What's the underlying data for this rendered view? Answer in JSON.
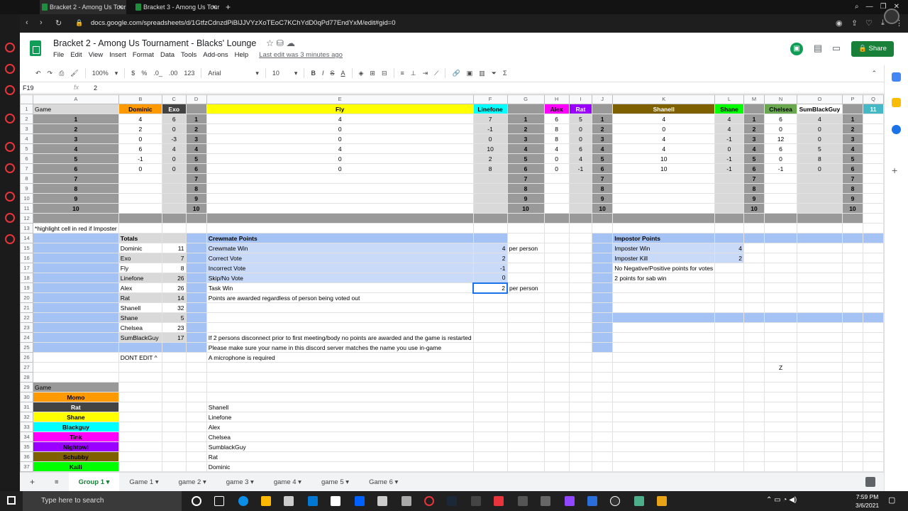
{
  "browser": {
    "tabs": [
      {
        "label": "Bracket 2 - Among Us Tour"
      },
      {
        "label": "Bracket 3 - Among Us Tour"
      }
    ],
    "url": "docs.google.com/spreadsheets/d/1GtfzCdnzdPiBlJJVYzXoTEoC7KChYdD0qPd77EndYxM/edit#gid=0"
  },
  "doc": {
    "title": "Bracket 2 - Among Us Tournament - Blacks' Lounge",
    "menu": [
      "File",
      "Edit",
      "View",
      "Insert",
      "Format",
      "Data",
      "Tools",
      "Add-ons",
      "Help"
    ],
    "last_edit": "Last edit was 3 minutes ago",
    "share": "Share"
  },
  "toolbar": {
    "zoom": "100%",
    "currency": "$",
    "percent": "%",
    "dec1": ".0_",
    "dec2": ".00",
    "fmt": "123",
    "font": "Arial",
    "size": "10"
  },
  "formula": {
    "cell": "F19",
    "fx": "fx",
    "value": "2"
  },
  "grid": {
    "cols": [
      "",
      "A",
      "B",
      "C",
      "D",
      "E",
      "F",
      "G",
      "H",
      "I",
      "J",
      "K",
      "L",
      "M",
      "N",
      "O",
      "P",
      "Q"
    ],
    "rows": [
      [
        "1",
        "Game",
        "Dominic",
        "Exo",
        "",
        "Fly",
        "Linefone",
        "",
        "Alex",
        "Rat",
        "",
        "Shanell",
        "Shane",
        "",
        "Chelsea",
        "SumBlackGuy",
        "",
        "11"
      ],
      [
        "2",
        "1",
        "4",
        "6",
        "1",
        "4",
        "7",
        "1",
        "6",
        "5",
        "1",
        "4",
        "4",
        "1",
        "6",
        "4",
        "1",
        ""
      ],
      [
        "3",
        "2",
        "2",
        "0",
        "2",
        "0",
        "-1",
        "2",
        "8",
        "0",
        "2",
        "0",
        "4",
        "2",
        "0",
        "0",
        "2",
        ""
      ],
      [
        "4",
        "3",
        "0",
        "-3",
        "3",
        "0",
        "0",
        "3",
        "8",
        "0",
        "3",
        "4",
        "-1",
        "3",
        "12",
        "0",
        "3",
        ""
      ],
      [
        "5",
        "4",
        "6",
        "4",
        "4",
        "4",
        "10",
        "4",
        "4",
        "6",
        "4",
        "4",
        "0",
        "4",
        "6",
        "5",
        "4",
        ""
      ],
      [
        "6",
        "5",
        "-1",
        "0",
        "5",
        "0",
        "2",
        "5",
        "0",
        "4",
        "5",
        "10",
        "-1",
        "5",
        "0",
        "8",
        "5",
        ""
      ],
      [
        "7",
        "6",
        "0",
        "0",
        "6",
        "0",
        "8",
        "6",
        "0",
        "-1",
        "6",
        "10",
        "-1",
        "6",
        "-1",
        "0",
        "6",
        ""
      ],
      [
        "8",
        "7",
        "",
        "",
        "7",
        "",
        "",
        "7",
        "",
        "",
        "7",
        "",
        "",
        "7",
        "",
        "",
        "7",
        ""
      ],
      [
        "9",
        "8",
        "",
        "",
        "8",
        "",
        "",
        "8",
        "",
        "",
        "8",
        "",
        "",
        "8",
        "",
        "",
        "8",
        ""
      ],
      [
        "10",
        "9",
        "",
        "",
        "9",
        "",
        "",
        "9",
        "",
        "",
        "9",
        "",
        "",
        "9",
        "",
        "",
        "9",
        ""
      ],
      [
        "11",
        "10",
        "",
        "",
        "10",
        "",
        "",
        "10",
        "",
        "",
        "10",
        "",
        "",
        "10",
        "",
        "",
        "10",
        ""
      ],
      [
        "12",
        "",
        "",
        "",
        "",
        "",
        "",
        "",
        "",
        "",
        "",
        "",
        "",
        "",
        "",
        "",
        "",
        ""
      ],
      [
        "13",
        "*highlight cell in red if Imposter",
        "",
        "",
        "",
        "",
        "",
        "",
        "",
        "",
        "",
        "",
        "",
        "",
        "",
        "",
        "",
        ""
      ],
      [
        "14",
        "",
        "Totals",
        "",
        "",
        "Crewmate Points",
        "",
        "",
        "",
        "",
        "",
        "Impostor Points",
        "",
        "",
        "",
        "",
        "",
        ""
      ],
      [
        "15",
        "",
        "Dominic",
        "11",
        "",
        "Crewmate Win",
        "4",
        "per person",
        "",
        "",
        "",
        "Imposter Win",
        "4",
        "",
        "",
        "",
        "",
        ""
      ],
      [
        "16",
        "",
        "Exo",
        "7",
        "",
        "Correct Vote",
        "2",
        "",
        "",
        "",
        "",
        "Imposter Kill",
        "2",
        "",
        "",
        "",
        "",
        ""
      ],
      [
        "17",
        "",
        "Fly",
        "8",
        "",
        "Incorrect Vote",
        "-1",
        "",
        "",
        "",
        "",
        "No Negative/Positive points for votes",
        "",
        "",
        "",
        "",
        "",
        ""
      ],
      [
        "18",
        "",
        "Linefone",
        "26",
        "",
        "Skip/No Vote",
        "0",
        "",
        "",
        "",
        "",
        "2 points for sab win",
        "",
        "",
        "",
        "",
        "",
        ""
      ],
      [
        "19",
        "",
        "Alex",
        "26",
        "",
        "Task Win",
        "2",
        "per person",
        "",
        "",
        "",
        "",
        "",
        "",
        "",
        "",
        "",
        ""
      ],
      [
        "20",
        "",
        "Rat",
        "14",
        "",
        "Points are awarded regardless of person being voted out",
        "",
        "",
        "",
        "",
        "",
        "",
        "",
        "",
        "",
        "",
        "",
        ""
      ],
      [
        "21",
        "",
        "Shanell",
        "32",
        "",
        "",
        "",
        "",
        "",
        "",
        "",
        "",
        "",
        "",
        "",
        "",
        "",
        ""
      ],
      [
        "22",
        "",
        "Shane",
        "5",
        "",
        "",
        "",
        "",
        "",
        "",
        "",
        "",
        "",
        "",
        "",
        "",
        "",
        ""
      ],
      [
        "23",
        "",
        "Chelsea",
        "23",
        "",
        "",
        "",
        "",
        "",
        "",
        "",
        "",
        "",
        "",
        "",
        "",
        "",
        ""
      ],
      [
        "24",
        "",
        "SumBlackGuy",
        "17",
        "",
        "If 2 persons disconnect prior to first meeting/body no points are awarded and the game is restarted",
        "",
        "",
        "",
        "",
        "",
        "",
        "",
        "",
        "",
        "",
        "",
        ""
      ],
      [
        "25",
        "",
        "",
        "",
        "",
        "Please make sure your name in this discord server matches the name you use in-game",
        "",
        "",
        "",
        "",
        "",
        "",
        "",
        "",
        "",
        "",
        "",
        ""
      ],
      [
        "26",
        "",
        "DONT EDIT ^",
        "",
        "",
        "A microphone is required",
        "",
        "",
        "",
        "",
        "",
        "",
        "",
        "",
        "",
        "",
        "",
        ""
      ],
      [
        "27",
        "",
        "",
        "",
        "",
        "",
        "",
        "",
        "",
        "",
        "",
        "",
        "",
        "",
        "Z",
        "",
        "",
        ""
      ],
      [
        "28",
        "",
        "",
        "",
        "",
        "",
        "",
        "",
        "",
        "",
        "",
        "",
        "",
        "",
        "",
        "",
        "",
        ""
      ],
      [
        "29",
        "Game",
        "",
        "",
        "",
        "",
        "",
        "",
        "",
        "",
        "",
        "",
        "",
        "",
        "",
        "",
        "",
        ""
      ],
      [
        "30",
        "Momo",
        "",
        "",
        "",
        "",
        "",
        "",
        "",
        "",
        "",
        "",
        "",
        "",
        "",
        "",
        "",
        ""
      ],
      [
        "31",
        "Rat",
        "",
        "",
        "",
        "Shanell",
        "",
        "",
        "",
        "",
        "",
        "",
        "",
        "",
        "",
        "",
        "",
        ""
      ],
      [
        "32",
        "Shane",
        "",
        "",
        "",
        "Linefone",
        "",
        "",
        "",
        "",
        "",
        "",
        "",
        "",
        "",
        "",
        "",
        ""
      ],
      [
        "33",
        "Blackguy",
        "",
        "",
        "",
        "Alex",
        "",
        "",
        "",
        "",
        "",
        "",
        "",
        "",
        "",
        "",
        "",
        ""
      ],
      [
        "34",
        "Tink",
        "",
        "",
        "",
        "Chelsea",
        "",
        "",
        "",
        "",
        "",
        "",
        "",
        "",
        "",
        "",
        "",
        ""
      ],
      [
        "35",
        "Nightowl",
        "",
        "",
        "",
        "SumblackGuy",
        "",
        "",
        "",
        "",
        "",
        "",
        "",
        "",
        "",
        "",
        "",
        ""
      ],
      [
        "36",
        "Schubby",
        "",
        "",
        "",
        "Rat",
        "",
        "",
        "",
        "",
        "",
        "",
        "",
        "",
        "",
        "",
        "",
        ""
      ],
      [
        "37",
        "Kaili",
        "",
        "",
        "",
        "Dominic",
        "",
        "",
        "",
        "",
        "",
        "",
        "",
        "",
        "",
        "",
        "",
        ""
      ]
    ]
  },
  "sheets": [
    "Group 1",
    "Game 1",
    "game 2",
    "game 3",
    "game 4",
    "game 5",
    "Game 6"
  ],
  "taskbar": {
    "search": "Type here to search",
    "time": "7:59 PM",
    "date": "3/6/2021"
  },
  "colors": {
    "orange": "#ff9900",
    "dark": "#434343",
    "yellow": "#ffff00",
    "cyan": "#00ffff",
    "magenta": "#ff00ff",
    "purple": "#9900ff",
    "olive": "#7f6000",
    "green": "#00ff00",
    "lightgreen": "#6aa84f",
    "grey": "#999999",
    "blue": "#a4c2f4",
    "teal": "#45b8c6"
  }
}
